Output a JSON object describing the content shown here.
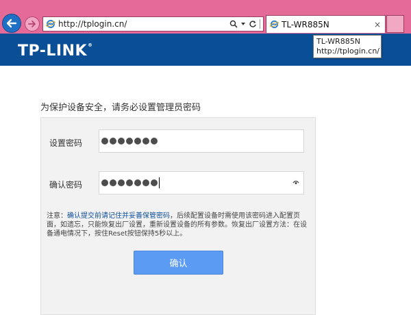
{
  "browser": {
    "url": "http://tplogin.cn/",
    "tab_title": "TL-WR885N",
    "tab_close": "×",
    "tooltip": {
      "line1": "TL-WR885N",
      "line2": "http://tplogin.cn/"
    }
  },
  "header": {
    "logo": "TP-LINK",
    "logo_mark": "®"
  },
  "page": {
    "instruction": "为保护设备安全，请务必设置管理员密码",
    "fields": [
      {
        "label": "设置密码",
        "masked_length": 7
      },
      {
        "label": "确认密码",
        "masked_length": 7
      }
    ],
    "note": {
      "prefix": "注意：",
      "highlight": "确认提交前请记住并妥善保管密码",
      "rest": "，后续配置设备时需使用该密码进入配置页面，如遗忘，只能恢复出厂设置，重新设置设备的所有参数。恢复出厂设置方法：在设备通电情况下，按住Reset按钮保持5秒以上。"
    },
    "confirm_label": "确认"
  },
  "colors": {
    "chrome": "#e46a97",
    "brand_blue": "#0a4f95",
    "button": "#5b9bf3"
  }
}
